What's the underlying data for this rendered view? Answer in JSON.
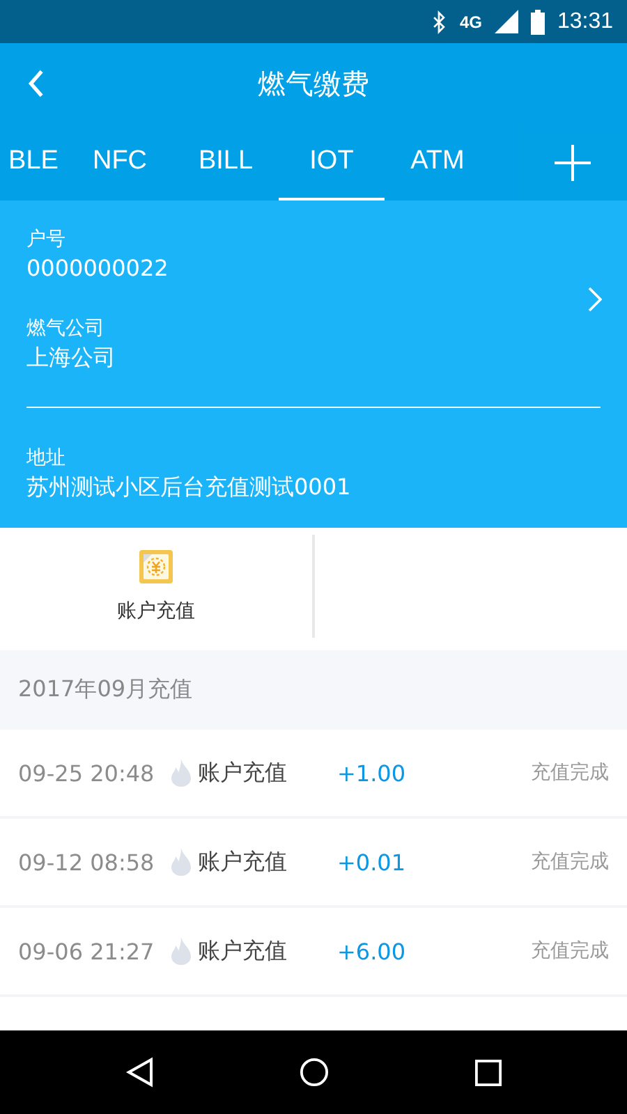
{
  "status_bar": {
    "network": "4G",
    "time": "13:31"
  },
  "app_bar": {
    "title": "燃气缴费"
  },
  "tabs": [
    {
      "label": "BLE",
      "selected": false
    },
    {
      "label": "NFC",
      "selected": false
    },
    {
      "label": "BILL",
      "selected": false
    },
    {
      "label": "IOT",
      "selected": true
    },
    {
      "label": "ATM",
      "selected": false
    }
  ],
  "account": {
    "fields": [
      {
        "label": "户号",
        "value": "0000000022"
      },
      {
        "label": "燃气公司",
        "value": "上海公司"
      }
    ],
    "address": {
      "label": "地址",
      "value": "苏州测试小区后台充值测试0001"
    }
  },
  "actions": [
    {
      "label": "账户充值"
    }
  ],
  "history": {
    "month": "2017年09月充值",
    "rows": [
      {
        "time": "09-25 20:48",
        "type": "账户充值",
        "amount": "+1.00",
        "status": "充值完成"
      },
      {
        "time": "09-12 08:58",
        "type": "账户充值",
        "amount": "+0.01",
        "status": "充值完成"
      },
      {
        "time": "09-06 21:27",
        "type": "账户充值",
        "amount": "+6.00",
        "status": "充值完成"
      }
    ]
  }
}
